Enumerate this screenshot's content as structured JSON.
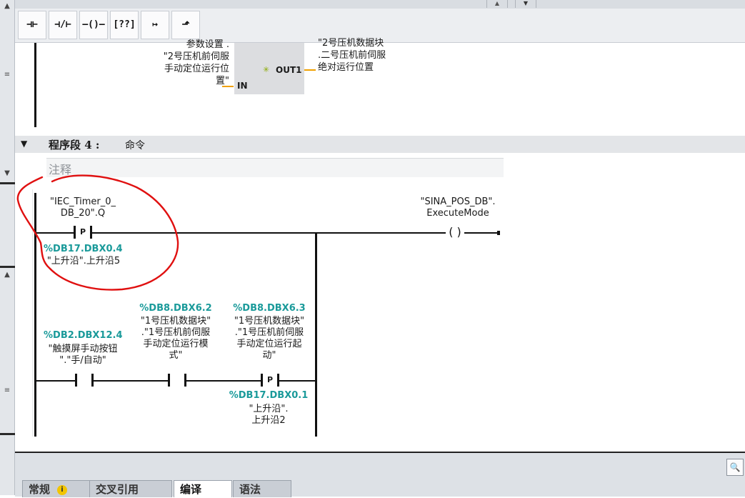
{
  "toolbar": {
    "items": [
      {
        "name": "no-contact-icon",
        "glyph": "⊣⊢"
      },
      {
        "name": "nc-contact-icon",
        "glyph": "⊣/⊢"
      },
      {
        "name": "coil-icon",
        "glyph": "–()–"
      },
      {
        "name": "empty-box-icon",
        "glyph": "[??]"
      },
      {
        "name": "open-branch-icon",
        "glyph": "↦"
      },
      {
        "name": "close-branch-icon",
        "glyph": "⬏"
      }
    ]
  },
  "segment3": {
    "in_label_lines": [
      "参数设置 .",
      "\"2号压机前伺服",
      "手动定位运行位",
      "置\""
    ],
    "in_pin": "IN",
    "out_pin": "OUT1",
    "out_label_lines": [
      "\"2号压机数据块",
      ".二号压机前伺服",
      "绝对运行位置"
    ]
  },
  "segment4": {
    "header": "程序段 4 :",
    "title": "命令",
    "comment_placeholder": "注释",
    "contact1": {
      "tag_lines": [
        "\"IEC_Timer_0_",
        "DB_20\".Q"
      ],
      "edge": "P",
      "addr": "%DB17.DBX0.4",
      "addr_desc": "\"上升沿\".上升沿5"
    },
    "contact2": {
      "addr": "%DB2.DBX12.4",
      "desc_lines": [
        "\"触摸屏手动按钮",
        "\".\"手/自动\""
      ]
    },
    "contact3": {
      "addr": "%DB8.DBX6.2",
      "desc_lines": [
        "\"1号压机数据块\"",
        ".\"1号压机前伺服",
        "手动定位运行模",
        "式\""
      ]
    },
    "contact4": {
      "addr": "%DB8.DBX6.3",
      "desc_lines": [
        "\"1号压机数据块\"",
        ".\"1号压机前伺服",
        "手动定位运行起",
        "动\""
      ]
    },
    "contact5": {
      "edge": "P",
      "addr": "%DB17.DBX0.1",
      "desc_lines": [
        "\"上升沿\".",
        "上升沿2"
      ]
    },
    "coil": {
      "tag_lines": [
        "\"SINA_POS_DB\".",
        "ExecuteMode"
      ]
    }
  },
  "bottom_tabs": [
    {
      "label": "常规",
      "active": false
    },
    {
      "label": "交叉引用",
      "active": false
    },
    {
      "label": "编译",
      "active": true
    },
    {
      "label": "语法",
      "active": false
    }
  ],
  "colors": {
    "address": "#1a9a9a",
    "annotation": "#e01010",
    "toolbar_bg": "#eceef1"
  }
}
